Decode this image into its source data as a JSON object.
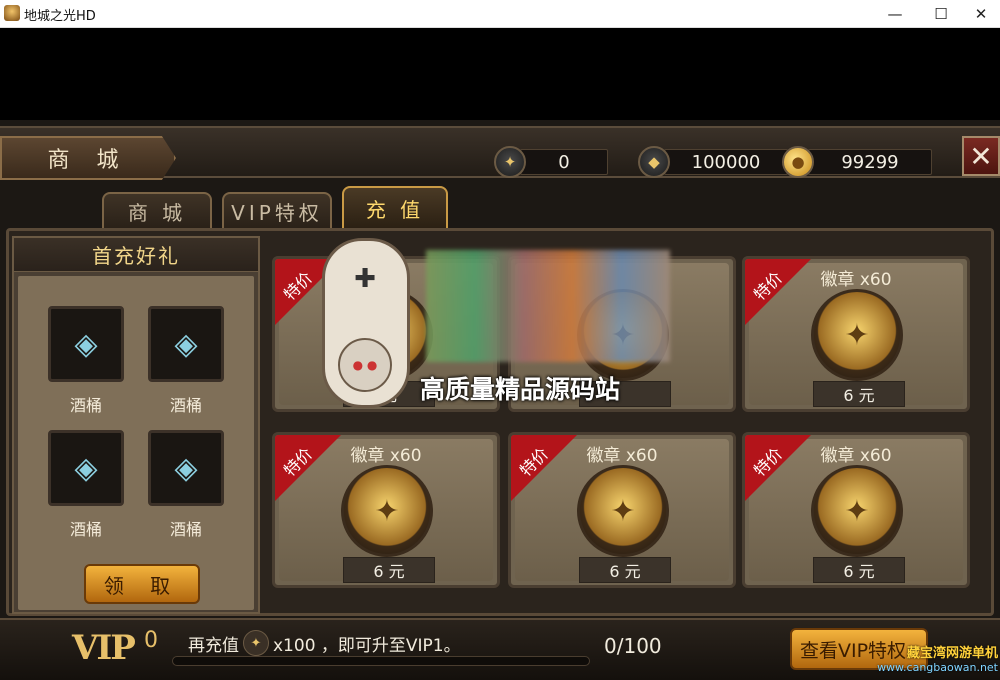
{
  "window": {
    "title": "地城之光HD",
    "minimize": "—",
    "maximize": "☐",
    "close": "✕"
  },
  "header": {
    "title": "商 城",
    "currencies": [
      {
        "icon": "diamond-emblem-icon",
        "value": "0"
      },
      {
        "icon": "crystal-icon",
        "value": "100000"
      },
      {
        "icon": "gold-coins-icon",
        "value": "99299"
      }
    ],
    "close_glyph": "✕"
  },
  "tabs": [
    {
      "label": "商 城",
      "active": false
    },
    {
      "label": "VIP特权",
      "active": false
    },
    {
      "label": "充 值",
      "active": true
    }
  ],
  "first_charge": {
    "title": "首充好礼",
    "items": [
      {
        "label": "酒桶",
        "icon": "barrel-icon"
      },
      {
        "label": "酒桶",
        "icon": "barrel-icon"
      },
      {
        "label": "酒桶",
        "icon": "barrel-icon"
      },
      {
        "label": "酒桶",
        "icon": "barrel-icon"
      }
    ],
    "claim_label": "领 取"
  },
  "products": [
    {
      "ribbon": "特价",
      "name": "",
      "price": "元"
    },
    {
      "ribbon": "",
      "name": "",
      "price": ""
    },
    {
      "ribbon": "特价",
      "name": "徽章 x60",
      "price": "6 元"
    },
    {
      "ribbon": "特价",
      "name": "徽章 x60",
      "price": "6 元"
    },
    {
      "ribbon": "特价",
      "name": "徽章 x60",
      "price": "6 元"
    },
    {
      "ribbon": "特价",
      "name": "徽章 x60",
      "price": "6 元"
    }
  ],
  "watermark": {
    "text": "高质量精品源码站"
  },
  "vip_bar": {
    "logo": "VIP",
    "level": "0",
    "hint_prefix": "再充值",
    "hint_suffix": "x100 ，即可升至VIP1。",
    "progress_text": "0/100",
    "progress_fraction": 0,
    "view_button": "查看VIP特权"
  },
  "site_watermark": {
    "line1": "藏宝湾网游单机",
    "line2": "www.cangbaowan.net"
  }
}
